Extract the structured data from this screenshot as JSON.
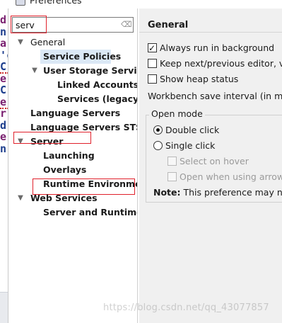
{
  "window": {
    "title": "Preferences"
  },
  "filter": {
    "value": "serv"
  },
  "editor_edge": {
    "lines": [
      {
        "text": "d",
        "color": "#7a2070"
      },
      {
        "text": "n",
        "color": "#1c3d8c"
      },
      {
        "text": "a",
        "color": "#7a2070"
      },
      {
        "text": "'c",
        "color": "#1c3d8c"
      },
      {
        "text": "C",
        "color": "#1c3d8c"
      },
      {
        "text": "e",
        "color": "#7a2070"
      },
      {
        "text": "C",
        "color": "#1c3d8c"
      },
      {
        "text": "e",
        "color": "#7a2070"
      },
      {
        "text": "r",
        "color": "#7a2070"
      },
      {
        "text": "d",
        "color": "#1c3d8c"
      },
      {
        "text": "e",
        "color": "#7a2070"
      },
      {
        "text": "n",
        "color": "#1c3d8c"
      }
    ]
  },
  "tree": {
    "general": "General",
    "service_policies": "Service Policies",
    "user_storage_service": "User Storage Service",
    "linked_accounts": "Linked Accounts",
    "services_legacy": "Services (legacy)",
    "language_servers": "Language Servers",
    "language_servers_sts": "Language Servers STS",
    "server": "Server",
    "launching": "Launching",
    "overlays": "Overlays",
    "runtime_environments": "Runtime Environme",
    "web_services": "Web Services",
    "server_and_runtime": "Server and Runtime"
  },
  "pane": {
    "title": "General",
    "always_run_in_background": "Always run in background",
    "keep_next_previous": "Keep next/previous editor, vie",
    "show_heap_status": "Show heap status",
    "save_interval": "Workbench save interval (in minu",
    "open_mode": "Open mode",
    "double_click": "Double click",
    "single_click": "Single click",
    "select_on_hover": "Select on hover",
    "open_when_arrow": "Open when using arrow k",
    "note_label": "Note:",
    "note_text": "This preference may not"
  },
  "watermark": "https://blog.csdn.net/qq_43077857"
}
